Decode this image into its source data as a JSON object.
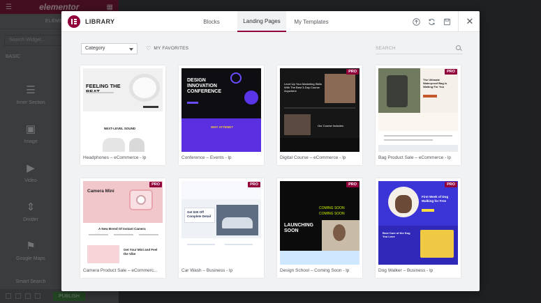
{
  "background_editor": {
    "brand": "elementor",
    "tabs": [
      "ELEMENTS"
    ],
    "search_placeholder": "Search Widget...",
    "category": "BASIC",
    "widgets": [
      "Inner Section",
      "Image",
      "Video",
      "Divider",
      "Google Maps",
      "Smart Search"
    ],
    "publish_label": "PUBLISH"
  },
  "header": {
    "title": "LIBRARY",
    "tabs": [
      {
        "label": "Blocks",
        "active": false
      },
      {
        "label": "Landing Pages",
        "active": true
      },
      {
        "label": "My Templates",
        "active": false
      }
    ],
    "actions": [
      "upload-icon",
      "sync-icon",
      "save-icon",
      "close-icon"
    ]
  },
  "filters": {
    "category_value": "Category",
    "favorites_label": "MY FAVORITES",
    "search_placeholder": "SEARCH"
  },
  "templates": [
    {
      "name": "Headphones – eCommerce - lp",
      "pro": false,
      "thumb_text": [
        "FEELING THE BEAT",
        "NEXT-LEVEL SOUND"
      ]
    },
    {
      "name": "Conference – Events - lp",
      "pro": false,
      "thumb_text": [
        "DESIGN",
        "INNOVATION",
        "CONFERENCE",
        "WHY ATTEND?"
      ]
    },
    {
      "name": "Digital Course – eCommerce - lp",
      "pro": true,
      "thumb_text": [
        "Level Up Your Marketing Skills With The Best 3-Day Course Anywhere",
        "Our Course Includes:"
      ]
    },
    {
      "name": "Bag Product Sale – eCommerce - lp",
      "pro": true,
      "thumb_text": [
        "The Ultimate Waterproof Bag Is Waiting For You"
      ]
    },
    {
      "name": "Camera Product Sale – eCommerc...",
      "pro": true,
      "thumb_text": [
        "Camera Mini",
        "A New Breed Of Instant Camera",
        "Get Your Mini and Feel the Vibe"
      ]
    },
    {
      "name": "Car Wash – Business - lp",
      "pro": true,
      "thumb_text": [
        "Get $30 Off Complete Detail"
      ]
    },
    {
      "name": "Design School – Coming Soon - lp",
      "pro": true,
      "thumb_text": [
        "LAUNCHING SOON",
        "COMING SOON"
      ]
    },
    {
      "name": "Dog Walker – Business - lp",
      "pro": true,
      "thumb_text": [
        "First Week of Dog Walking for Free",
        "Best Care of the Dog You Love"
      ]
    }
  ],
  "colors": {
    "brand": "#92003b",
    "modal_bg": "#f1f2f3",
    "overlay": "#000000"
  }
}
